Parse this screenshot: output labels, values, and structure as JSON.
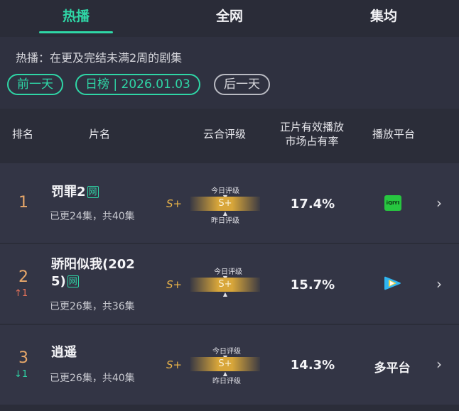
{
  "tabs": [
    {
      "label": "热播",
      "active": true
    },
    {
      "label": "全网",
      "active": false
    },
    {
      "label": "集均",
      "active": false
    }
  ],
  "description": "热播：在更及完结未满2周的剧集",
  "date_nav": {
    "prev_label": "前一天",
    "date_label": "日榜 | 2026.01.03",
    "next_label": "后一天"
  },
  "columns": {
    "rank": "排名",
    "title": "片名",
    "rating": "云合评级",
    "share_line1": "正片有效播放",
    "share_line2": "市场占有率",
    "platform": "播放平台"
  },
  "rating_labels": {
    "today": "今日评级",
    "yesterday": "昨日评级"
  },
  "rows": [
    {
      "rank": "1",
      "trend": "",
      "title": "罚罪2",
      "badge": "网",
      "episodes": "已更24集，共40集",
      "rating": "S+",
      "rating_bar": "S+",
      "share": "17.4%",
      "platform_icon": "iqiyi-icon",
      "platform_icon_text": "iQIYI"
    },
    {
      "rank": "2",
      "trend": "↑1",
      "title_line1": "骄阳似我(202",
      "title_line2": "5)",
      "badge": "网",
      "episodes": "已更26集，共36集",
      "rating": "S+",
      "rating_bar": "S+",
      "share": "15.7%",
      "platform_icon": "tencent-video-icon"
    },
    {
      "rank": "3",
      "trend": "↓1",
      "title": "逍遥",
      "episodes": "已更26集，共40集",
      "rating": "S+",
      "rating_bar": "S+",
      "share": "14.3%",
      "platform": "多平台"
    }
  ],
  "colors": {
    "accent": "#2fd6a6",
    "rank": "#e8a86a",
    "rating_gold": "#d8a63a",
    "background": "#2b2d39"
  }
}
